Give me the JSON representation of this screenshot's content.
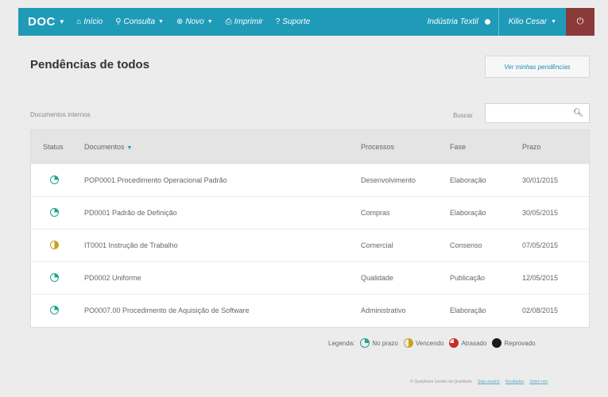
{
  "nav": {
    "brand": "DOC",
    "items": [
      {
        "icon": "home-icon",
        "label": "Início"
      },
      {
        "icon": "search-icon",
        "label": "Consulta",
        "dropdown": true
      },
      {
        "icon": "plus-circle-icon",
        "label": "Novo",
        "dropdown": true
      },
      {
        "icon": "printer-icon",
        "label": "Imprimir"
      },
      {
        "icon": "help-circle-icon",
        "label": "Suporte"
      }
    ],
    "company": "Indústria Textil",
    "user": "Kilio Cesar"
  },
  "page": {
    "title": "Pendências de todos",
    "my_pending_button": "Ver minhas pendências",
    "section_label": "Documentos internos",
    "search_label": "Buscar",
    "search_value": ""
  },
  "table": {
    "headers": {
      "status": "Status",
      "documents": "Documentos",
      "processes": "Processos",
      "phase": "Fase",
      "deadline": "Prazo"
    },
    "rows": [
      {
        "status": "ok",
        "document": "POP0001 Procedimento Operacional Padrão",
        "process": "Desenvolvimento",
        "phase": "Elaboração",
        "deadline": "30/01/2015"
      },
      {
        "status": "ok",
        "document": "PD0001 Padrão de Definição",
        "process": "Compras",
        "phase": "Elaboração",
        "deadline": "30/05/2015"
      },
      {
        "status": "warn",
        "document": "IT0001 Instrução de Trabalho",
        "process": "Comercial",
        "phase": "Consenso",
        "deadline": "07/05/2015"
      },
      {
        "status": "ok",
        "document": "PD0002 Uniforme",
        "process": "Qualidade",
        "phase": "Publicação",
        "deadline": "12/05/2015"
      },
      {
        "status": "ok",
        "document": "PO0007.00 Procedimento de Aquisição de Software",
        "process": "Administrativo",
        "phase": "Elaboração",
        "deadline": "02/08/2015"
      }
    ]
  },
  "legend": {
    "title": "Legenda:",
    "items": [
      {
        "status": "ok",
        "label": "No prazo"
      },
      {
        "status": "warn",
        "label": "Vencendo"
      },
      {
        "status": "late",
        "label": "Atrasado"
      },
      {
        "status": "rej",
        "label": "Reprovado"
      }
    ]
  },
  "footer": {
    "text": "© Qualyteam Gestão da Qualidade",
    "links": [
      "Seja usuário",
      "Novidades",
      "Sobre nós"
    ]
  },
  "colors": {
    "nav": "#1f9bb8",
    "power": "#8b3a3a",
    "accent": "#1e8fb0"
  }
}
